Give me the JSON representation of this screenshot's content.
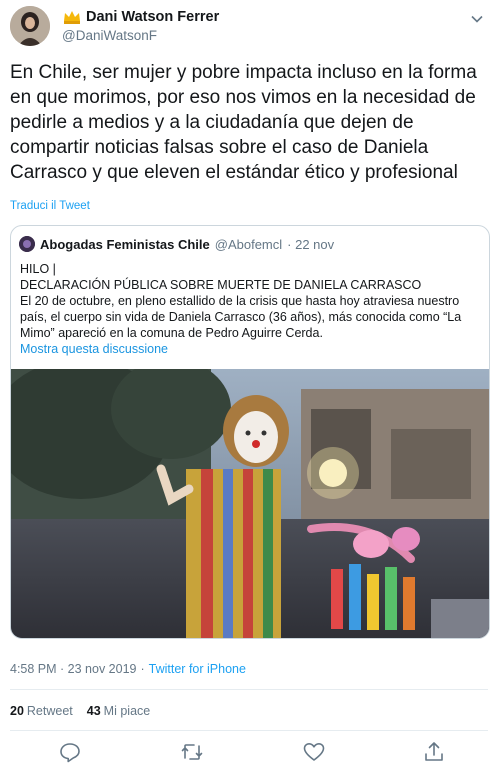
{
  "tweet": {
    "author_name": "Dani Watson Ferrer",
    "author_handle": "@DaniWatsonF",
    "text": "En Chile, ser mujer y pobre impacta incluso en la forma en que morimos, por eso nos vimos en la necesidad de pedirle a medios y a la ciudadanía que dejen de compartir noticias falsas sobre el caso de Daniela Carrasco y que eleven el estándar ético y profesional",
    "translate_label": "Traduci il Tweet",
    "timestamp": "4:58 PM · 23 nov 2019",
    "separator": "·",
    "source": "Twitter for iPhone",
    "retweets_count": "20",
    "retweets_label": "Retweet",
    "likes_count": "43",
    "likes_label": "Mi piace"
  },
  "quoted": {
    "author_name": "Abogadas Feministas Chile",
    "author_handle": "@Abofemcl",
    "date": "· 22 nov",
    "line1": "HILO |",
    "line2": "DECLARACIÓN PÚBLICA SOBRE MUERTE DE DANIELA CARRASCO",
    "line3": "El 20 de octubre, en pleno estallido de la crisis que hasta hoy atraviesa nuestro país, el cuerpo sin vida de Daniela Carrasco (36 años), más conocida como “La Mimo” apareció en la comuna de Pedro Aguirre Cerda.",
    "show_thread": "Mostra questa discussione"
  },
  "icons": {
    "badge": "crown-icon",
    "menu": "chevron-down-icon",
    "reply": "reply-icon",
    "retweet": "retweet-icon",
    "like": "heart-icon",
    "share": "share-icon"
  },
  "colors": {
    "link": "#1da1f2",
    "muted": "#657786",
    "text": "#14171a",
    "border": "#ccd6dd"
  }
}
